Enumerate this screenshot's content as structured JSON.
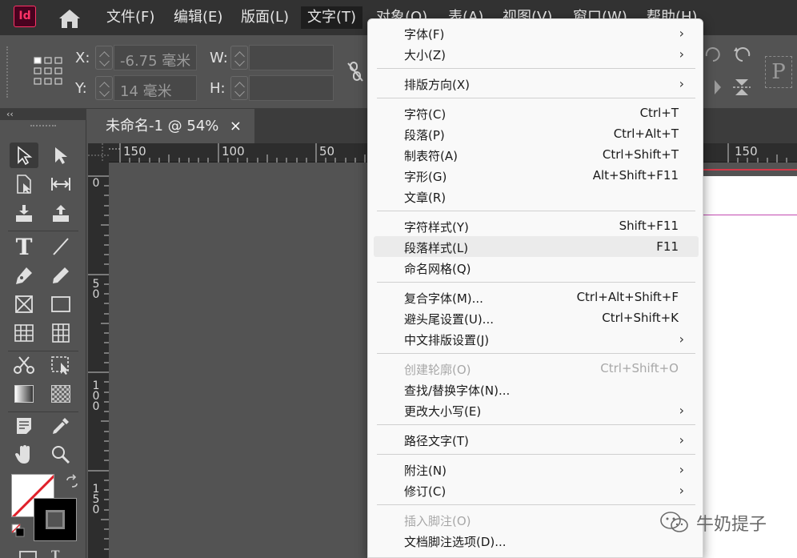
{
  "menubar": {
    "logo": "Id",
    "items": [
      "文件(F)",
      "编辑(E)",
      "版面(L)",
      "文字(T)",
      "对象(O)",
      "表(A)",
      "视图(V)",
      "窗口(W)",
      "帮助(H)"
    ]
  },
  "control": {
    "x_label": "X:",
    "x_value": "-6.75 毫米",
    "y_label": "Y:",
    "y_value": "14 毫米",
    "w_label": "W:",
    "h_label": "H:"
  },
  "document": {
    "tab_title": "未命名-1 @ 54%",
    "close": "×"
  },
  "ruler": {
    "top": [
      "150",
      "100",
      "50",
      "150"
    ],
    "left": [
      "0",
      "5\n0",
      "1\n0\n0",
      "1\n5\n0"
    ]
  },
  "dropdown": {
    "items": [
      {
        "label": "字体(F)",
        "shortcut": "",
        "submenu": true
      },
      {
        "label": "大小(Z)",
        "shortcut": "",
        "submenu": true
      },
      {
        "label": "排版方向(X)",
        "shortcut": "",
        "submenu": true
      },
      {
        "label": "字符(C)",
        "shortcut": "Ctrl+T",
        "submenu": false
      },
      {
        "label": "段落(P)",
        "shortcut": "Ctrl+Alt+T",
        "submenu": false
      },
      {
        "label": "制表符(A)",
        "shortcut": "Ctrl+Shift+T",
        "submenu": false
      },
      {
        "label": "字形(G)",
        "shortcut": "Alt+Shift+F11",
        "submenu": false
      },
      {
        "label": "文章(R)",
        "shortcut": "",
        "submenu": false
      },
      {
        "label": "字符样式(Y)",
        "shortcut": "Shift+F11",
        "submenu": false
      },
      {
        "label": "段落样式(L)",
        "shortcut": "F11",
        "submenu": false
      },
      {
        "label": "命名网格(Q)",
        "shortcut": "",
        "submenu": false
      },
      {
        "label": "复合字体(M)...",
        "shortcut": "Ctrl+Alt+Shift+F",
        "submenu": false
      },
      {
        "label": "避头尾设置(U)...",
        "shortcut": "Ctrl+Shift+K",
        "submenu": false
      },
      {
        "label": "中文排版设置(J)",
        "shortcut": "",
        "submenu": true
      },
      {
        "label": "创建轮廓(O)",
        "shortcut": "Ctrl+Shift+O",
        "submenu": false,
        "disabled": true
      },
      {
        "label": "查找/替换字体(N)...",
        "shortcut": "",
        "submenu": false
      },
      {
        "label": "更改大小写(E)",
        "shortcut": "",
        "submenu": true
      },
      {
        "label": "路径文字(T)",
        "shortcut": "",
        "submenu": true
      },
      {
        "label": "附注(N)",
        "shortcut": "",
        "submenu": true
      },
      {
        "label": "修订(C)",
        "shortcut": "",
        "submenu": true
      },
      {
        "label": "插入脚注(O)",
        "shortcut": "",
        "submenu": false,
        "disabled": true
      },
      {
        "label": "文档脚注选项(D)...",
        "shortcut": "",
        "submenu": false
      }
    ],
    "arrow": "›"
  },
  "watermark": {
    "text": "牛奶提子"
  },
  "colors": {
    "accent": "#ff3366",
    "menu_bg": "#f9f9f9",
    "ui_bg": "#535353",
    "menubar_bg": "#323232"
  }
}
